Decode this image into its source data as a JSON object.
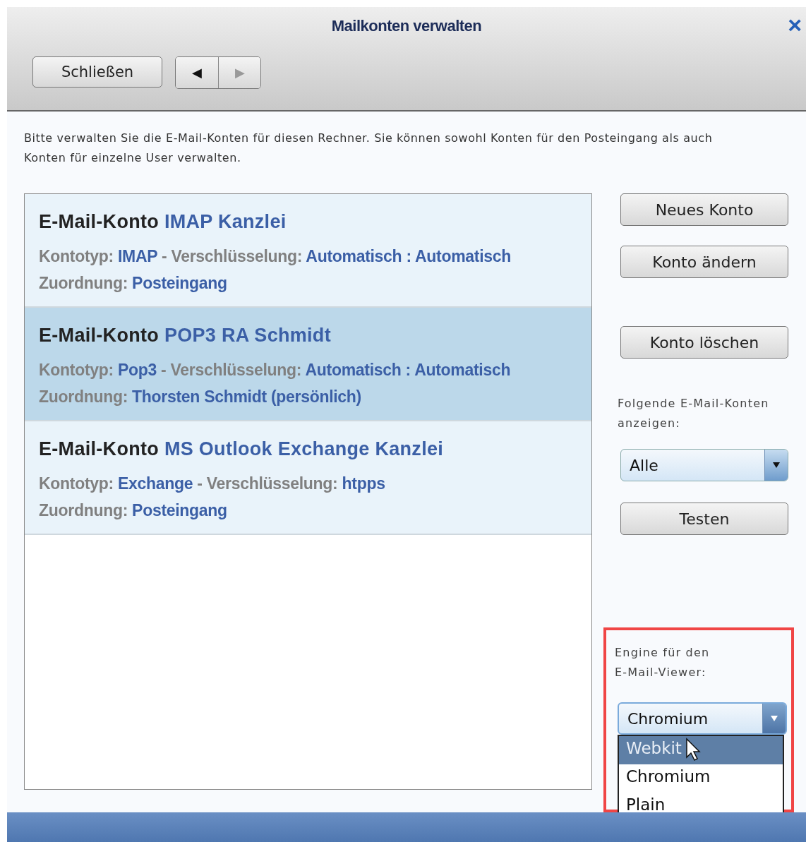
{
  "window": {
    "title": "Mailkonten verwalten",
    "close": "×"
  },
  "toolbar": {
    "close_button": "Schließen",
    "back": "◀",
    "forward": "▶"
  },
  "intro": "Bitte verwalten Sie die E-Mail-Konten für diesen Rechner. Sie können sowohl Konten für den Posteingang als auch Konten für einzelne User verwalten.",
  "accounts": [
    {
      "prefix": "E-Mail-Konto",
      "name": "IMAP Kanzlei",
      "type_label": "Kontotyp:",
      "type": "IMAP",
      "enc_label": "- Verschlüsselung:",
      "encryption": "Automatisch : Automatisch",
      "assign_label": "Zuordnung:",
      "assignment": "Posteingang",
      "selected": false
    },
    {
      "prefix": "E-Mail-Konto",
      "name": "POP3 RA Schmidt",
      "type_label": "Kontotyp:",
      "type": "Pop3",
      "enc_label": "- Verschlüsselung:",
      "encryption": "Automatisch : Automatisch",
      "assign_label": "Zuordnung:",
      "assignment": "Thorsten Schmidt (persönlich)",
      "selected": true
    },
    {
      "prefix": "E-Mail-Konto",
      "name": "MS Outlook Exchange Kanzlei",
      "type_label": "Kontotyp:",
      "type": "Exchange",
      "enc_label": "- Verschlüsselung:",
      "encryption": "htpps",
      "assign_label": "Zuordnung:",
      "assignment": "Posteingang",
      "selected": false
    }
  ],
  "actions": [
    "Neues Konto",
    "Konto ändern",
    "Konto löschen"
  ],
  "filter": {
    "label": "Folgende E-Mail-Konten anzeigen:",
    "value": "Alle"
  },
  "test_button": "Testen",
  "engine": {
    "label": "Engine für den E-Mail-Viewer:",
    "value": "Chromium",
    "options": [
      {
        "label": "Webkit",
        "highlighted": true
      },
      {
        "label": "Chromium",
        "highlighted": false
      },
      {
        "label": "Plain",
        "highlighted": false
      }
    ]
  }
}
